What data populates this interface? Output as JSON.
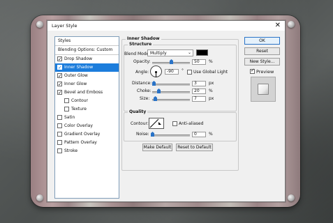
{
  "window": {
    "title": "Layer Style",
    "close_glyph": "✕"
  },
  "styles_list": {
    "header": "Styles",
    "blending_options": "Blending Options: Custom",
    "items": [
      {
        "label": "Drop Shadow",
        "checked": true,
        "selected": false
      },
      {
        "label": "Inner Shadow",
        "checked": true,
        "selected": true
      },
      {
        "label": "Outer Glow",
        "checked": true,
        "selected": false
      },
      {
        "label": "Inner Glow",
        "checked": true,
        "selected": false
      },
      {
        "label": "Bevel and Emboss",
        "checked": true,
        "selected": false
      },
      {
        "label": "Contour",
        "checked": false,
        "selected": false
      },
      {
        "label": "Texture",
        "checked": false,
        "selected": false
      },
      {
        "label": "Satin",
        "checked": false,
        "selected": false
      },
      {
        "label": "Color Overlay",
        "checked": false,
        "selected": false
      },
      {
        "label": "Gradient Overlay",
        "checked": false,
        "selected": false
      },
      {
        "label": "Pattern Overlay",
        "checked": false,
        "selected": false
      },
      {
        "label": "Stroke",
        "checked": false,
        "selected": false
      }
    ]
  },
  "inner_shadow": {
    "group_title": "Inner Shadow",
    "structure": {
      "title": "Structure",
      "blend_mode_label": "Blend Mode:",
      "blend_mode_value": "Multiply",
      "blend_color": "#000000",
      "opacity_label": "Opacity:",
      "opacity_value": "50",
      "opacity_unit": "%",
      "angle_label": "Angle:",
      "angle_value": "-90",
      "angle_unit": "°",
      "global_light_label": "Use Global Light",
      "global_light_checked": false,
      "distance_label": "Distance:",
      "distance_value": "3",
      "distance_unit": "px",
      "choke_label": "Choke:",
      "choke_value": "20",
      "choke_unit": "%",
      "size_label": "Size:",
      "size_value": "7",
      "size_unit": "px"
    },
    "quality": {
      "title": "Quality",
      "contour_label": "Contour:",
      "anti_aliased_label": "Anti-aliased",
      "anti_aliased_checked": false,
      "noise_label": "Noise:",
      "noise_value": "0",
      "noise_unit": "%"
    },
    "make_default_label": "Make Default",
    "reset_default_label": "Reset to Default"
  },
  "right_buttons": {
    "ok": "OK",
    "reset": "Reset",
    "new_style": "New Style...",
    "preview_label": "Preview",
    "preview_checked": true
  },
  "colors": {
    "selection": "#1c7ddc",
    "slider_thumb": "#2a73c7"
  }
}
